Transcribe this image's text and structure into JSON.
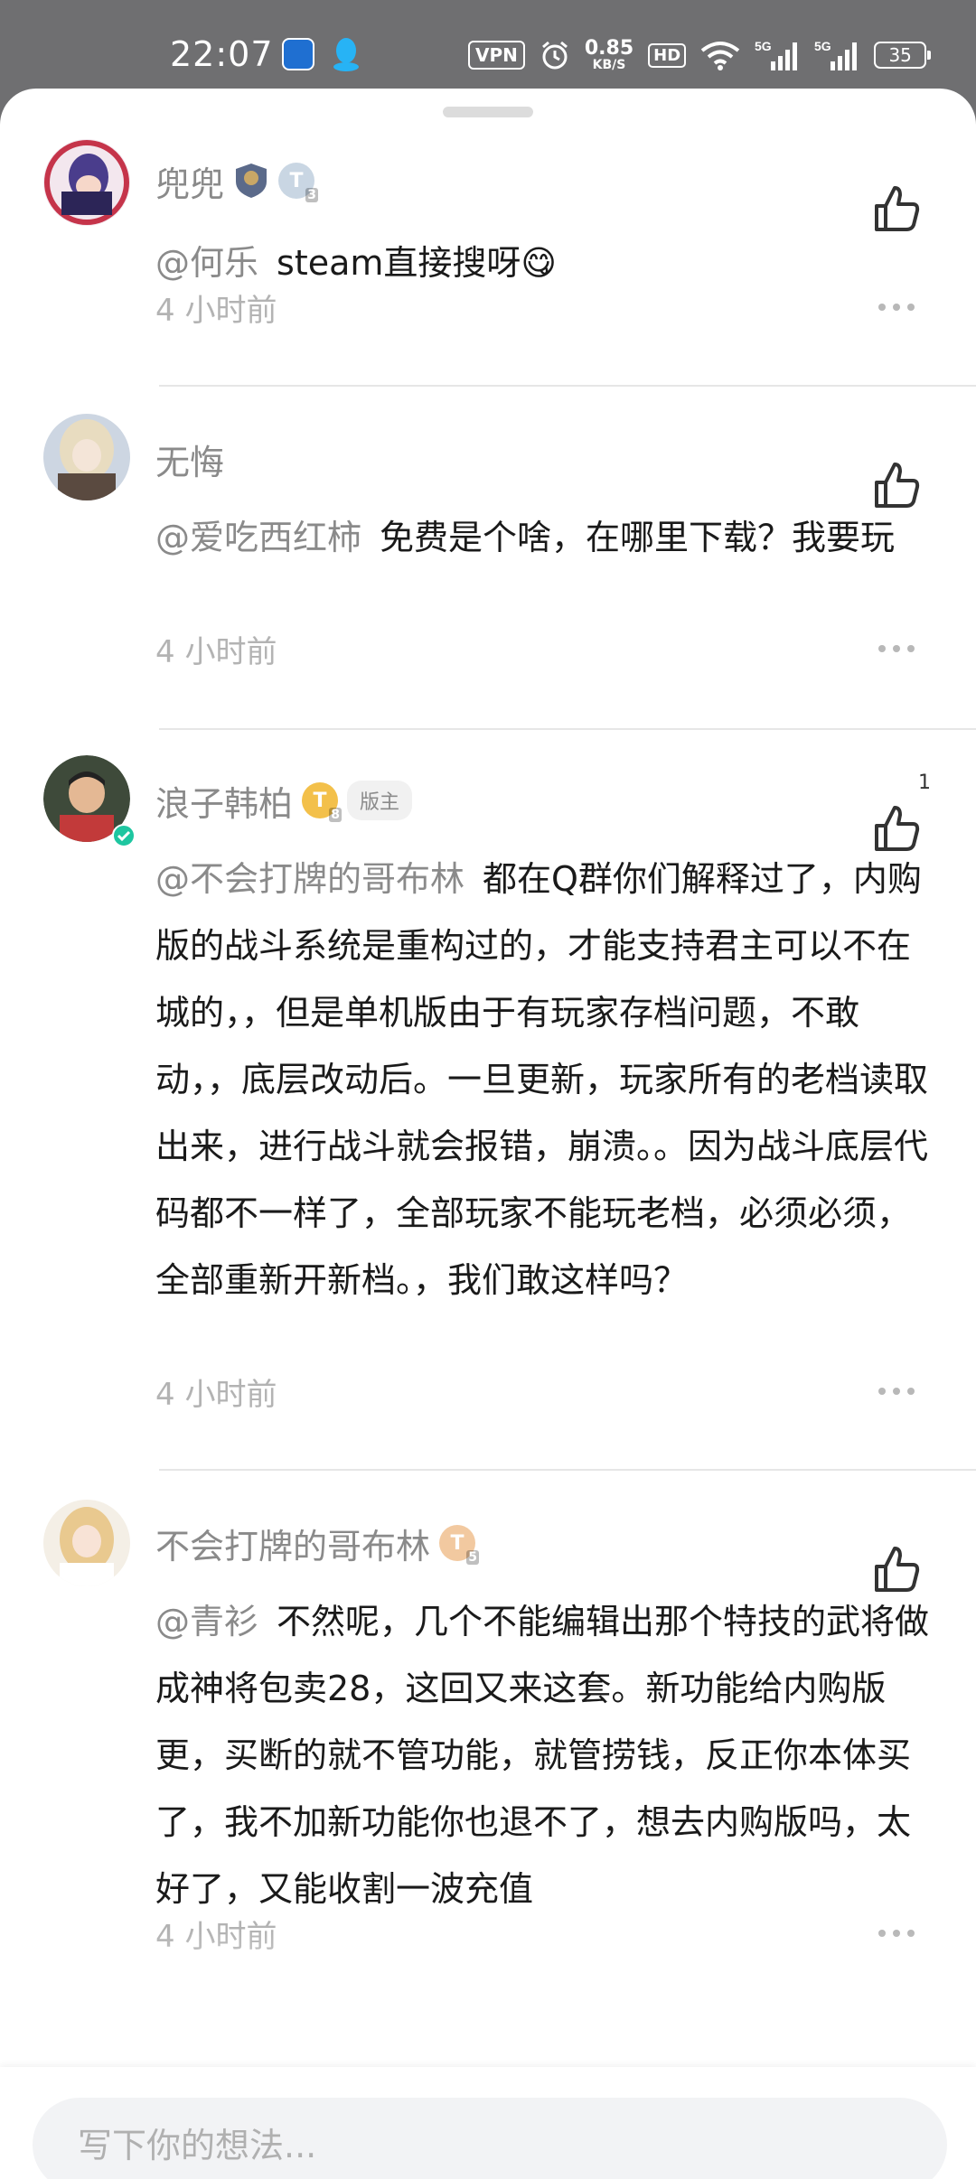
{
  "status_bar": {
    "time": "22:07",
    "vpn": "VPN",
    "speed_value": "0.85",
    "speed_unit": "KB/S",
    "hd": "HD",
    "battery": "35",
    "icons": [
      "app-icon",
      "qq-icon",
      "vpn-icon",
      "alarm-icon",
      "hd-icon",
      "wifi-icon",
      "signal-5g-icon",
      "signal-5g-icon",
      "battery-icon"
    ]
  },
  "comments": [
    {
      "name": "兜兜",
      "mention": "@何乐",
      "text": "steam直接搜呀😋",
      "time": "4 小时前",
      "like_count": ""
    },
    {
      "name": "无悔",
      "mention": "@爱吃西红柿",
      "text": "免费是个啥，在哪里下载？我要玩",
      "time": "4 小时前",
      "like_count": ""
    },
    {
      "name": "浪子韩柏",
      "mod_tag": "版主",
      "mention": "@不会打牌的哥布林",
      "text": "都在Q群你们解释过了，内购版的战斗系统是重构过的，才能支持君主可以不在城的，，但是单机版由于有玩家存档问题，不敢动，，底层改动后。一旦更新，玩家所有的老档读取出来，进行战斗就会报错，崩溃。。因为战斗底层代码都不一样了，全部玩家不能玩老档，必须必须，全部重新开新档。，我们敢这样吗？",
      "time": "4 小时前",
      "like_count": "1"
    },
    {
      "name": "不会打牌的哥布林",
      "mention": "@青衫",
      "text": "不然呢，几个不能编辑出那个特技的武将做成神将包卖28，这回又来这套。新功能给内购版更，买断的就不管功能，就管捞钱，反正你本体买了，我不加新功能你也退不了，想去内购版吗，太好了，又能收割一波充值",
      "time": "4 小时前",
      "like_count": ""
    }
  ],
  "composer": {
    "placeholder": "写下你的想法..."
  },
  "colors": {
    "accent_gray": "#8a8a8a",
    "badge_gold": "#f3c04a",
    "verified_green": "#1ec6a0"
  }
}
